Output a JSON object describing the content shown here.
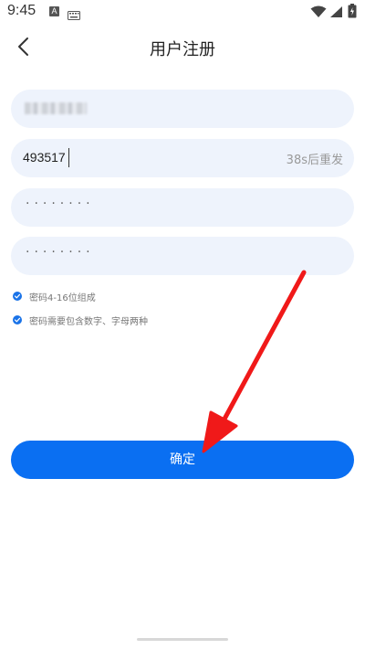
{
  "status_bar": {
    "time": "9:45",
    "notification_icon_letter": "A",
    "icons": [
      "a-app-icon",
      "keyboard-icon",
      "wifi-icon",
      "signal-icon",
      "battery-icon"
    ]
  },
  "header": {
    "title": "用户注册",
    "back_icon": "chevron-left-icon"
  },
  "form": {
    "phone": {
      "value_note": "blurred"
    },
    "code": {
      "value": "493517",
      "resend_label": "38s后重发"
    },
    "password": {
      "masked_value": "········"
    },
    "password_confirm": {
      "masked_value": "········"
    }
  },
  "rules": [
    {
      "text": "密码4-16位组成",
      "checked": true
    },
    {
      "text": "密码需要包含数字、字母两种",
      "checked": true
    }
  ],
  "confirm_button": {
    "label": "确定"
  },
  "colors": {
    "accent": "#0a6ff2",
    "field_bg": "#eef3fc",
    "annotation_arrow": "#f01919"
  }
}
